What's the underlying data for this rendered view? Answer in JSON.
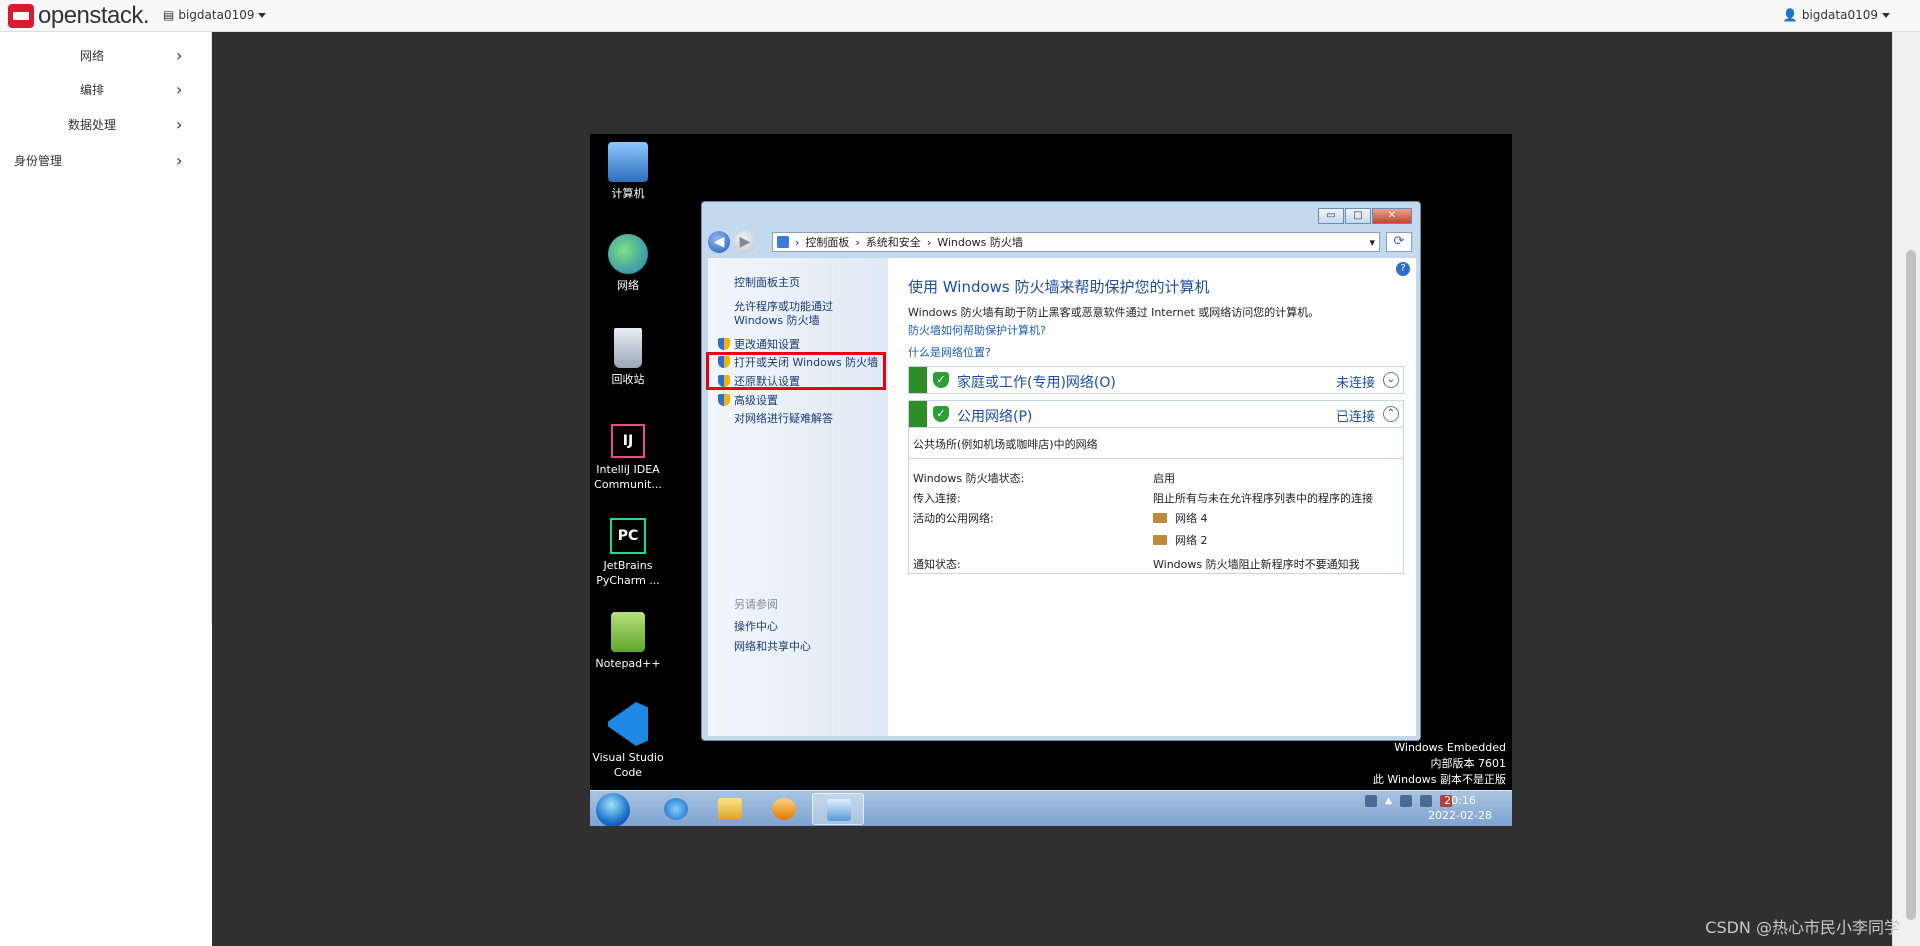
{
  "topbar": {
    "brand": "openstack.",
    "project": "bigdata0109",
    "user": "bigdata0109"
  },
  "sidebar": {
    "items": [
      {
        "label": "网络"
      },
      {
        "label": "编排"
      },
      {
        "label": "数据处理"
      },
      {
        "label": "身份管理"
      }
    ],
    "chevron": "›"
  },
  "desktop": {
    "icons": [
      {
        "label": "计算机",
        "icon": "computer-icon"
      },
      {
        "label": "网络",
        "icon": "network-globe-icon"
      },
      {
        "label": "回收站",
        "icon": "recycle-bin-icon"
      },
      {
        "label": "IntelliJ IDEA Communit...",
        "icon": "intellij-icon"
      },
      {
        "label": "JetBrains PyCharm ...",
        "icon": "pycharm-icon"
      },
      {
        "label": "Notepad++",
        "icon": "notepad-plus-plus-icon"
      },
      {
        "label": "Visual Studio Code",
        "icon": "vscode-icon"
      }
    ],
    "intellij_glyph": "IJ",
    "pycharm_glyph": "PC",
    "watermark": [
      "Windows Embedded",
      "内部版本 7601",
      "此 Windows 副本不是正版"
    ]
  },
  "window": {
    "breadcrumb": [
      "控制面板",
      "系统和安全",
      "Windows 防火墙"
    ],
    "help": "?",
    "left_links": [
      "控制面板主页",
      "允许程序或功能通过 Windows 防火墙",
      "更改通知设置",
      "打开或关闭 Windows 防火墙",
      "还原默认设置",
      "高级设置",
      "对网络进行疑难解答"
    ],
    "see_also_title": "另请参阅",
    "see_also": [
      "操作中心",
      "网络和共享中心"
    ],
    "main_title": "使用 Windows 防火墙来帮助保护您的计算机",
    "main_desc": "Windows 防火墙有助于防止黑客或恶意软件通过 Internet 或网络访问您的计算机。",
    "link1": "防火墙如何帮助保护计算机?",
    "link2": "什么是网络位置?",
    "networks": [
      {
        "name": "家庭或工作(专用)网络(O)",
        "status": "未连接",
        "expand": "⌄"
      },
      {
        "name": "公用网络(P)",
        "status": "已连接",
        "expand": "⌃"
      }
    ],
    "public_desc": "公共场所(例如机场或咖啡店)中的网络",
    "details": {
      "state_label": "Windows 防火墙状态:",
      "state_value": "启用",
      "incoming_label": "传入连接:",
      "incoming_value": "阻止所有与未在允许程序列表中的程序的连接",
      "active_label": "活动的公用网络:",
      "active_values": [
        "网络  4",
        "网络  2"
      ],
      "notify_label": "通知状态:",
      "notify_value": "Windows 防火墙阻止新程序时不要通知我"
    },
    "min_glyph": "▭",
    "max_glyph": "□",
    "close_glyph": "✕",
    "back_glyph": "◀",
    "fwd_glyph": "▶",
    "refresh_glyph": "⟳"
  },
  "taskbar": {
    "time": "20:16",
    "date": "2022-02-28"
  },
  "footer_watermark": "CSDN @热心市民小李同学",
  "colors": {
    "topbar": "#f8f8f8",
    "content_bg": "#303030",
    "highlight_box": "#e60012",
    "win_title_blue": "#1e4ea0",
    "net_green": "#2d8e27"
  }
}
